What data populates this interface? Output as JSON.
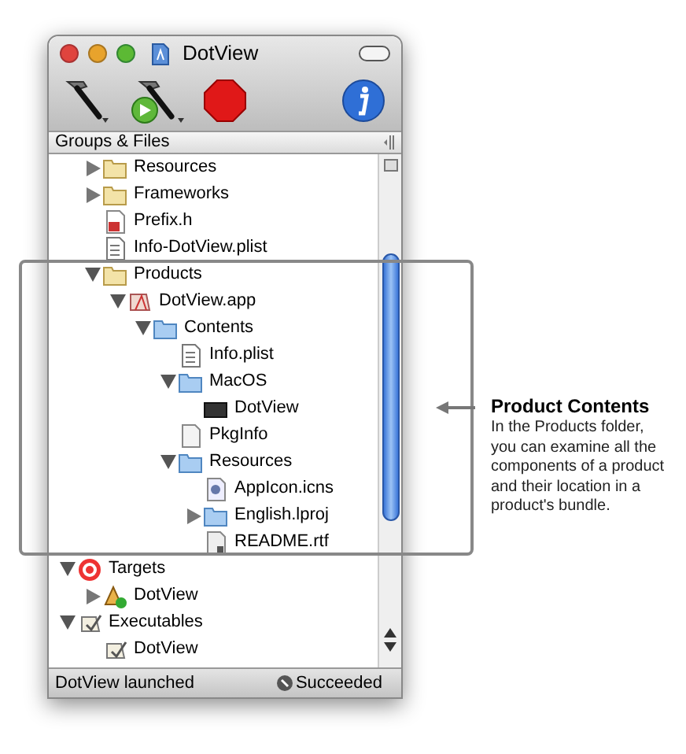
{
  "window": {
    "title": "DotView"
  },
  "sidebar_header": "Groups & Files",
  "tree": {
    "upper_items": [
      {
        "label": "Resources",
        "kind": "folder",
        "expanded": false
      },
      {
        "label": "Frameworks",
        "kind": "folder",
        "expanded": false
      },
      {
        "label": "Prefix.h",
        "kind": "header"
      },
      {
        "label": "Info-DotView.plist",
        "kind": "plist"
      },
      {
        "label": "Products",
        "kind": "folder",
        "expanded": true,
        "children": [
          {
            "label": "DotView.app",
            "kind": "app",
            "expanded": true,
            "children": [
              {
                "label": "Contents",
                "kind": "bluefolder",
                "expanded": true,
                "children": [
                  {
                    "label": "Info.plist",
                    "kind": "plist"
                  },
                  {
                    "label": "MacOS",
                    "kind": "bluefolder",
                    "expanded": true,
                    "children": [
                      {
                        "label": "DotView",
                        "kind": "binary"
                      }
                    ]
                  },
                  {
                    "label": "PkgInfo",
                    "kind": "document"
                  },
                  {
                    "label": "Resources",
                    "kind": "bluefolder",
                    "expanded": true,
                    "children": [
                      {
                        "label": "AppIcon.icns",
                        "kind": "icns"
                      },
                      {
                        "label": "English.lproj",
                        "kind": "bluefolder",
                        "expanded": false
                      },
                      {
                        "label": "README.rtf",
                        "kind": "rtf"
                      }
                    ]
                  }
                ]
              }
            ]
          }
        ]
      }
    ],
    "lower_items": [
      {
        "label": "Targets",
        "kind": "target",
        "expanded": true,
        "children": [
          {
            "label": "DotView",
            "kind": "buildtarget",
            "expanded": false
          }
        ]
      },
      {
        "label": "Executables",
        "kind": "executable",
        "expanded": true,
        "children": [
          {
            "label": "DotView",
            "kind": "executable"
          }
        ]
      }
    ]
  },
  "status_bar": {
    "message": "DotView launched",
    "result": "Succeeded"
  },
  "callout": {
    "title": "Product Contents",
    "body": "In the Products folder, you can examine all the components of a product and their location in a product's bundle."
  }
}
